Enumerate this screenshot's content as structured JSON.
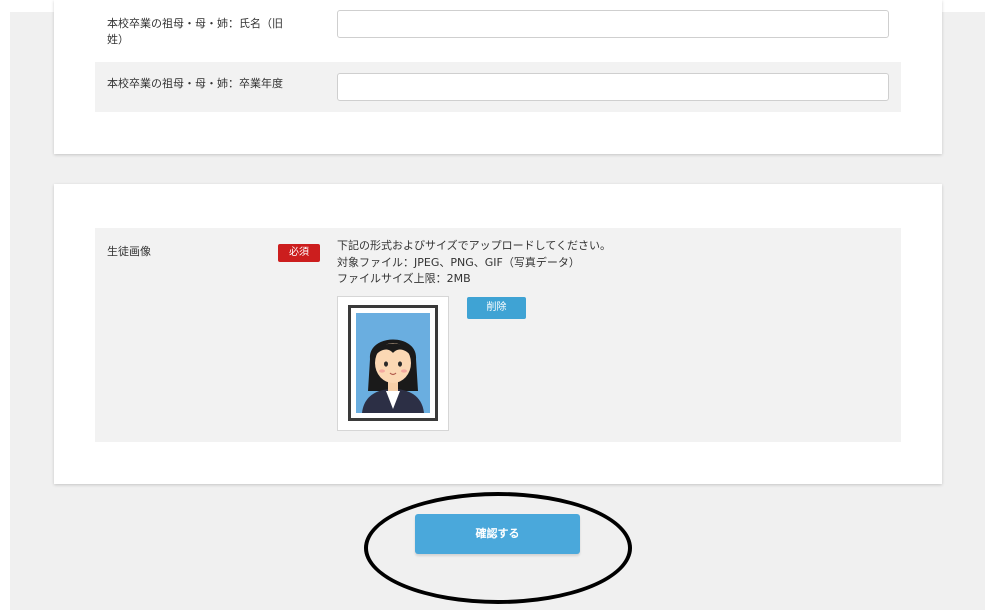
{
  "form": {
    "guardian_name": {
      "label": "本校卒業の祖母・母・姉：氏名（旧姓）",
      "value": ""
    },
    "guardian_year": {
      "label": "本校卒業の祖母・母・姉：卒業年度",
      "value": ""
    },
    "student_photo": {
      "label": "生徒画像",
      "required_badge": "必須",
      "instructions": [
        "下記の形式およびサイズでアップロードしてください。",
        "対象ファイル：JPEG、PNG、GIF（写真データ）",
        "ファイルサイズ上限：2MB"
      ],
      "delete_label": "削除"
    }
  },
  "actions": {
    "confirm_label": "確認する"
  },
  "colors": {
    "required": "#cc1e1e",
    "button": "#4aa8db",
    "photo_bg": "#6aaee0"
  }
}
